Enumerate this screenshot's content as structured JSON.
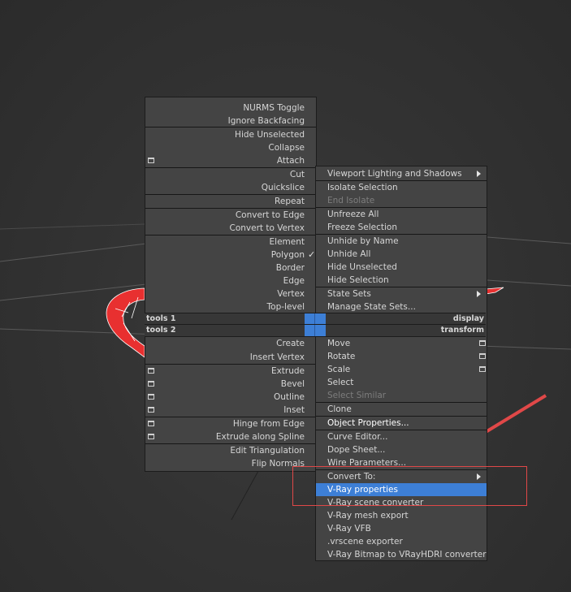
{
  "left_menu": {
    "items": [
      {
        "label": "NURMS Toggle"
      },
      {
        "label": "Ignore Backfacing"
      },
      {
        "label": "Hide Unselected"
      },
      {
        "label": "Collapse"
      },
      {
        "label": "Attach"
      },
      {
        "label": "Cut"
      },
      {
        "label": "Quickslice"
      },
      {
        "label": "Repeat"
      },
      {
        "label": "Convert to Edge"
      },
      {
        "label": "Convert to Vertex"
      },
      {
        "label": "Element"
      },
      {
        "label": "Polygon",
        "check": "✓"
      },
      {
        "label": "Border"
      },
      {
        "label": "Edge"
      },
      {
        "label": "Vertex"
      },
      {
        "label": "Top-level"
      },
      {
        "label": "Create"
      },
      {
        "label": "Insert Vertex"
      },
      {
        "label": "Extrude"
      },
      {
        "label": "Bevel"
      },
      {
        "label": "Outline"
      },
      {
        "label": "Inset"
      },
      {
        "label": "Hinge from Edge"
      },
      {
        "label": "Extrude along Spline"
      },
      {
        "label": "Edit Triangulation"
      },
      {
        "label": "Flip Normals"
      }
    ]
  },
  "quad_bars": {
    "tools1": "tools 1",
    "display": "display",
    "tools2": "tools 2",
    "transform": "transform"
  },
  "right_menu": {
    "items": [
      {
        "label": "Viewport Lighting and Shadows"
      },
      {
        "label": "Isolate Selection"
      },
      {
        "label": "End Isolate"
      },
      {
        "label": "Unfreeze All"
      },
      {
        "label": "Freeze Selection"
      },
      {
        "label": "Unhide by Name"
      },
      {
        "label": "Unhide All"
      },
      {
        "label": "Hide Unselected"
      },
      {
        "label": "Hide Selection"
      },
      {
        "label": "State Sets"
      },
      {
        "label": "Manage State Sets..."
      },
      {
        "label": "Move"
      },
      {
        "label": "Rotate"
      },
      {
        "label": "Scale"
      },
      {
        "label": "Select"
      },
      {
        "label": "Select Similar"
      },
      {
        "label": "Clone"
      },
      {
        "label": "Object Properties..."
      },
      {
        "label": "Curve Editor..."
      },
      {
        "label": "Dope Sheet..."
      },
      {
        "label": "Wire Parameters..."
      },
      {
        "label": "Convert To:"
      },
      {
        "label": "V-Ray properties"
      },
      {
        "label": "V-Ray scene converter"
      },
      {
        "label": "V-Ray mesh export"
      },
      {
        "label": "V-Ray VFB"
      },
      {
        "label": ".vrscene exporter"
      },
      {
        "label": "V-Ray Bitmap to VRayHDRI converter"
      }
    ]
  },
  "colors": {
    "menu_bg": "#444444",
    "highlight": "#3d7fd6",
    "annotation_red": "#e04848",
    "object_red": "#e83030"
  }
}
